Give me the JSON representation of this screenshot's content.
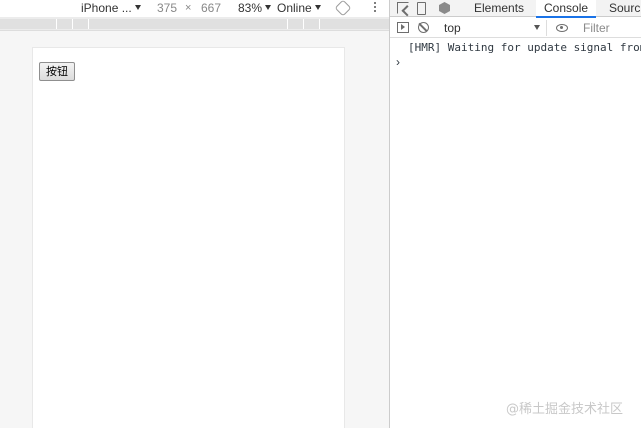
{
  "device_toolbar": {
    "device_name": "iPhone ...",
    "width": "375",
    "times": "×",
    "height": "667",
    "zoom": "83%",
    "network": "Online"
  },
  "page": {
    "button_label": "按钮"
  },
  "devtools": {
    "tabs": [
      "Elements",
      "Console",
      "Sourc"
    ],
    "active_tab": "Console",
    "context": "top",
    "filter_placeholder": "Filter",
    "log_lines": [
      "[HMR] Waiting for update signal from"
    ],
    "prompt": "›"
  },
  "watermark": "@稀土掘金技术社区",
  "colors": {
    "active_tab_underline": "#1a73e8",
    "toolbar_bg": "#f3f3f3"
  }
}
